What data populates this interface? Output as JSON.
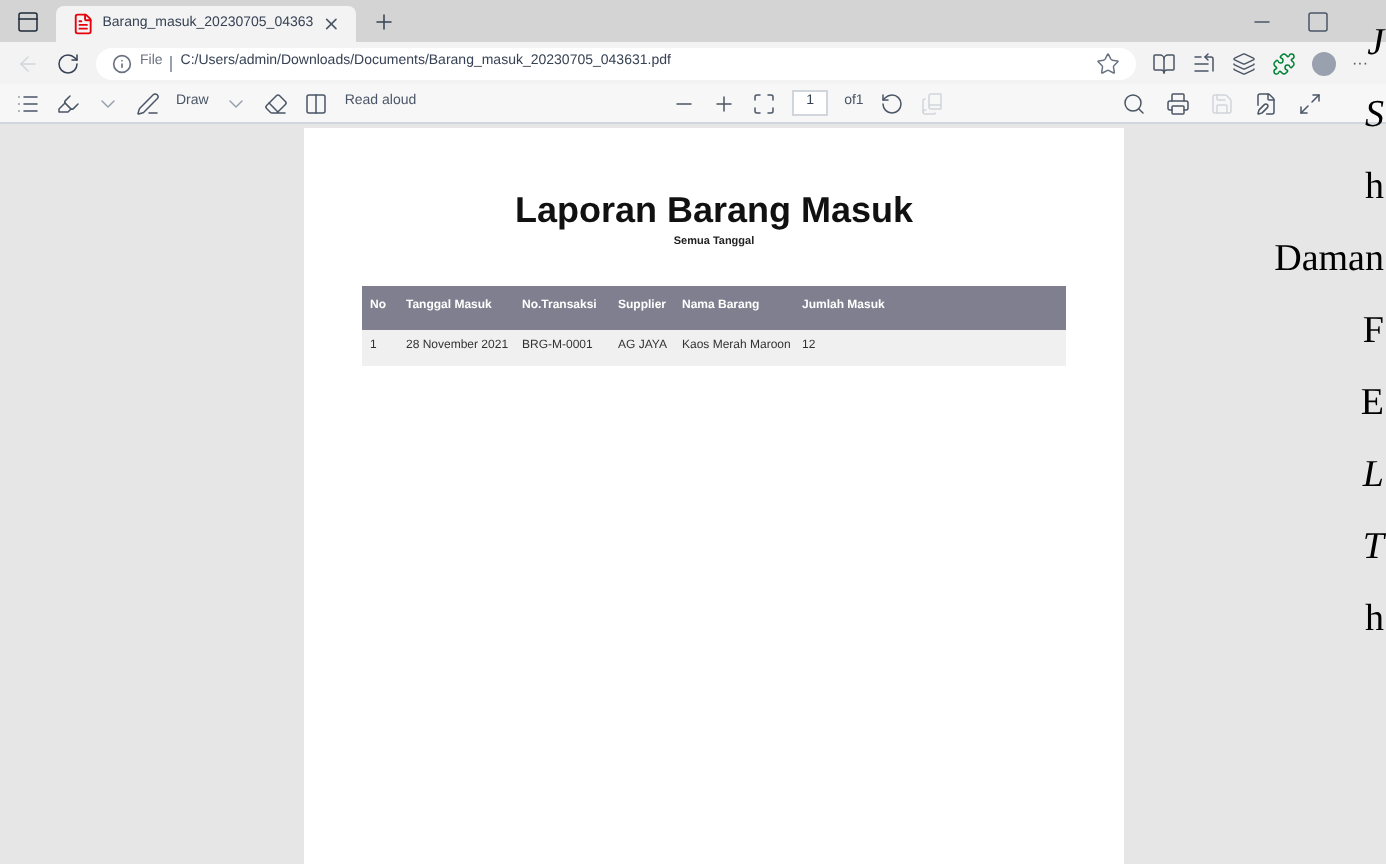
{
  "tab": {
    "title": "Barang_masuk_20230705_04363",
    "selected": true
  },
  "address": {
    "scheme": "File",
    "url": "C:/Users/admin/Downloads/Documents/Barang_masuk_20230705_043631.pdf",
    "more": "···"
  },
  "pdf_toolbar": {
    "draw": "Draw",
    "read_aloud": "Read aloud",
    "page": "1",
    "page_count": "of1"
  },
  "report": {
    "title": "Laporan Barang Masuk",
    "subtitle": "Semua Tanggal",
    "columns": [
      "No",
      "Tanggal Masuk",
      "No.Transaksi",
      "Supplier",
      "Nama Barang",
      "Jumlah Masuk"
    ],
    "rows": [
      [
        "1",
        "28 November 2021",
        "BRG-M-0001",
        "AG JAYA",
        "Kaos Merah Maroon",
        "12"
      ]
    ]
  },
  "overlay_text": [
    {
      "text": "J",
      "italic": true
    },
    {
      "text": "S",
      "italic": true
    },
    {
      "text": "h",
      "italic": false
    },
    {
      "text": "Daman",
      "italic": false
    },
    {
      "text": "F",
      "italic": false
    },
    {
      "text": "E",
      "italic": false
    },
    {
      "text": "L",
      "italic": true
    },
    {
      "text": "T",
      "italic": true
    },
    {
      "text": "h",
      "italic": false
    }
  ]
}
